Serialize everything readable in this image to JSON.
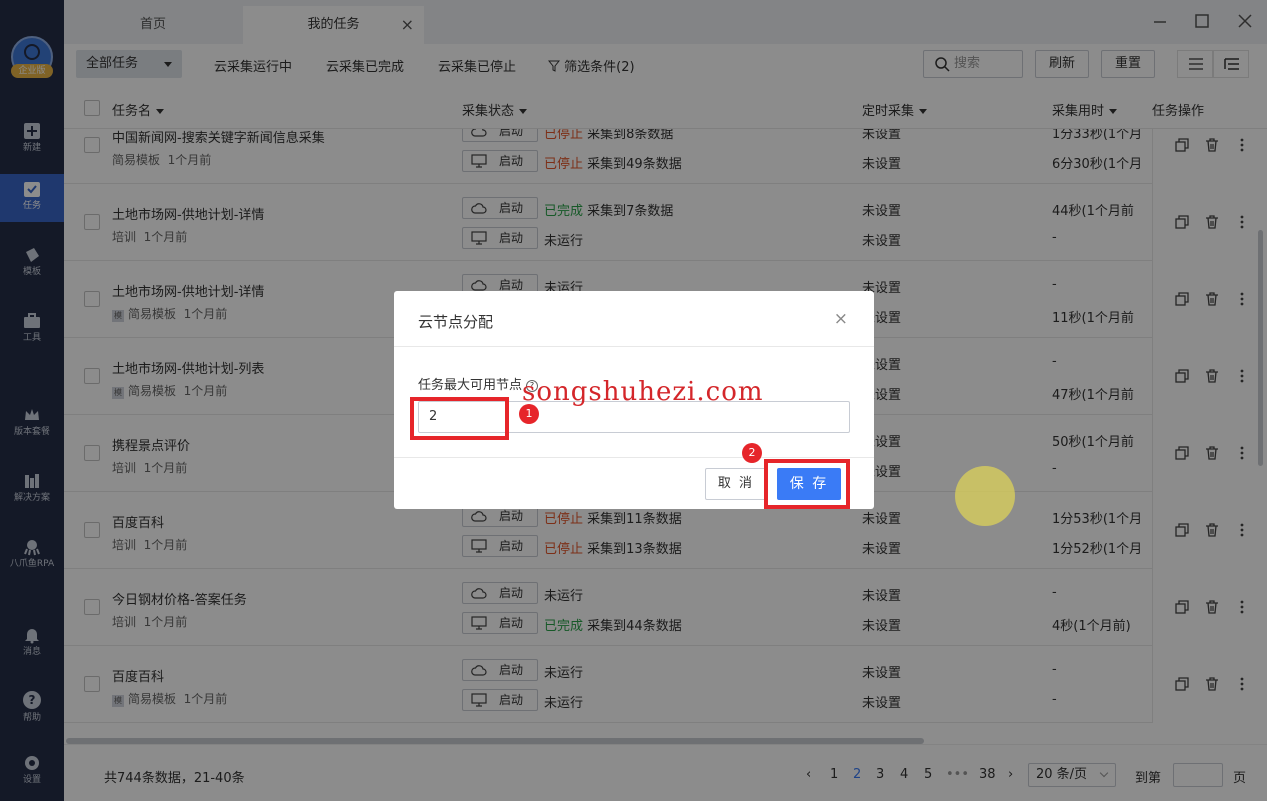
{
  "sidebar": {
    "logo_badge": "企业版",
    "items": [
      {
        "label": "新建",
        "icon": "plus-icon"
      },
      {
        "label": "任务",
        "icon": "task-icon"
      },
      {
        "label": "模板",
        "icon": "template-icon"
      },
      {
        "label": "工具",
        "icon": "toolbox-icon"
      },
      {
        "label": "版本套餐",
        "icon": "crown-icon"
      },
      {
        "label": "解决方案",
        "icon": "solution-icon"
      },
      {
        "label": "八爪鱼RPA",
        "icon": "octopus-icon"
      },
      {
        "label": "消息",
        "icon": "bell-icon"
      },
      {
        "label": "帮助",
        "icon": "help-icon"
      },
      {
        "label": "设置",
        "icon": "gear-icon"
      }
    ]
  },
  "tabs": [
    {
      "label": "首页"
    },
    {
      "label": "我的任务"
    }
  ],
  "toolbar": {
    "filter_select": "全部任务",
    "links": [
      "云采集运行中",
      "云采集已完成",
      "云采集已停止",
      "筛选条件(2)"
    ],
    "search_placeholder": "搜索",
    "refresh_label": "刷新",
    "reset_label": "重置"
  },
  "table": {
    "headers": [
      "任务名",
      "采集状态",
      "定时采集",
      "采集用时",
      "任务操作"
    ],
    "run_button_label": "启动",
    "rows": [
      {
        "name": "中国新闻网-搜索关键字新闻信息采集",
        "group": "简易模板",
        "time": "1个月前",
        "tag": false,
        "status": [
          {
            "state": "已停止",
            "kind": "stop",
            "detail": "采集到8条数据"
          },
          {
            "state": "已停止",
            "kind": "stop",
            "detail": "采集到49条数据"
          }
        ],
        "schedule": [
          "未设置",
          "未设置"
        ],
        "usage": [
          "1分33秒(1个月",
          "6分30秒(1个月"
        ]
      },
      {
        "name": "土地市场网-供地计划-详情",
        "group": "培训",
        "time": "1个月前",
        "tag": false,
        "status": [
          {
            "state": "已完成",
            "kind": "done",
            "detail": "采集到7条数据"
          },
          {
            "state": "未运行",
            "kind": "idle",
            "detail": ""
          }
        ],
        "schedule": [
          "未设置",
          "未设置"
        ],
        "usage": [
          "44秒(1个月前",
          "-"
        ]
      },
      {
        "name": "土地市场网-供地计划-详情",
        "group": "简易模板",
        "time": "1个月前",
        "tag": true,
        "status": [
          {
            "state": "未运行",
            "kind": "idle",
            "detail": ""
          },
          {
            "state": "",
            "kind": "idle",
            "detail": ""
          }
        ],
        "schedule": [
          "未设置",
          "未设置"
        ],
        "usage": [
          "-",
          "11秒(1个月前"
        ]
      },
      {
        "name": "土地市场网-供地计划-列表",
        "group": "简易模板",
        "time": "1个月前",
        "tag": true,
        "status": [
          {
            "state": "",
            "kind": "idle",
            "detail": ""
          },
          {
            "state": "",
            "kind": "idle",
            "detail": ""
          }
        ],
        "schedule": [
          "未设置",
          "未设置"
        ],
        "usage": [
          "-",
          "47秒(1个月前"
        ]
      },
      {
        "name": "携程景点评价",
        "group": "培训",
        "time": "1个月前",
        "tag": false,
        "status": [
          {
            "state": "",
            "kind": "idle",
            "detail": ""
          },
          {
            "state": "",
            "kind": "idle",
            "detail": ""
          }
        ],
        "schedule": [
          "未设置",
          "未设置"
        ],
        "usage": [
          "50秒(1个月前",
          "-"
        ]
      },
      {
        "name": "百度百科",
        "group": "培训",
        "time": "1个月前",
        "tag": false,
        "status": [
          {
            "state": "已停止",
            "kind": "stop",
            "detail": "采集到11条数据"
          },
          {
            "state": "已停止",
            "kind": "stop",
            "detail": "采集到13条数据"
          }
        ],
        "schedule": [
          "未设置",
          "未设置"
        ],
        "usage": [
          "1分53秒(1个月",
          "1分52秒(1个月"
        ]
      },
      {
        "name": "今日钢材价格-答案任务",
        "group": "培训",
        "time": "1个月前",
        "tag": false,
        "status": [
          {
            "state": "未运行",
            "kind": "idle",
            "detail": ""
          },
          {
            "state": "已完成",
            "kind": "done",
            "detail": "采集到44条数据"
          }
        ],
        "schedule": [
          "未设置",
          "未设置"
        ],
        "usage": [
          "-",
          "4秒(1个月前)"
        ]
      },
      {
        "name": "百度百科",
        "group": "简易模板",
        "time": "1个月前",
        "tag": true,
        "status": [
          {
            "state": "未运行",
            "kind": "idle",
            "detail": ""
          },
          {
            "state": "未运行",
            "kind": "idle",
            "detail": ""
          }
        ],
        "schedule": [
          "未设置",
          "未设置"
        ],
        "usage": [
          "-",
          "-"
        ]
      }
    ]
  },
  "footer": {
    "total": "共744条数据，21-40条",
    "pages": [
      "1",
      "2",
      "3",
      "4",
      "5",
      "•••",
      "38"
    ],
    "current_page": "2",
    "page_size": "20 条/页",
    "goto_label": "到第",
    "page_suffix": "页"
  },
  "modal": {
    "title": "云节点分配",
    "label": "任务最大可用节点",
    "value": "2",
    "cancel_label": "取 消",
    "save_label": "保 存"
  },
  "annotations": {
    "watermark": "songshuhezi.com",
    "badge1": "1",
    "badge2": "2",
    "highlight_color": "#e6252a"
  },
  "colors": {
    "sidebar_bg": "#262f48",
    "accent": "#3a7bf6",
    "stopped": "#e3562a",
    "done": "#2aa34a"
  }
}
